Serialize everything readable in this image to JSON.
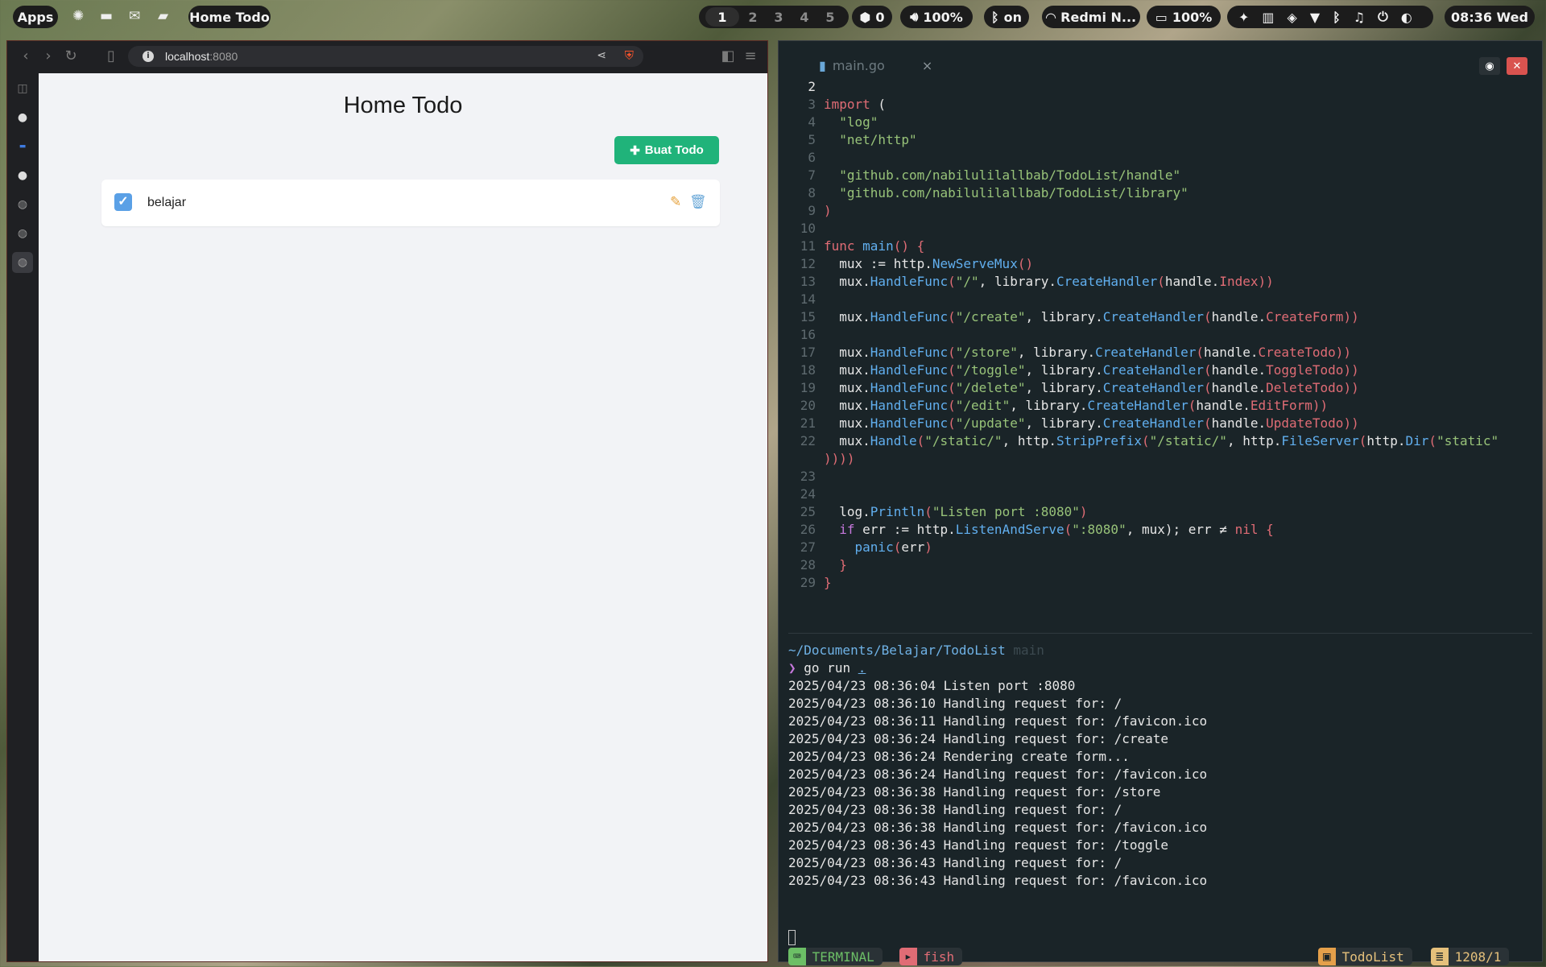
{
  "topbar": {
    "apps_label": "Apps",
    "active_window_title": "Home Todo",
    "workspaces": [
      "1",
      "2",
      "3",
      "4",
      "5"
    ],
    "windows_count": "0",
    "volume": "100%",
    "bluetooth": "on",
    "wifi": "Redmi N...",
    "battery": "100%",
    "clock": "08:36 Wed"
  },
  "browser": {
    "url_host": "localhost",
    "url_port": ":8080"
  },
  "todo_app": {
    "title": "Home Todo",
    "create_button": "Buat Todo",
    "todos": [
      {
        "text": "belajar",
        "done": true
      }
    ]
  },
  "editor": {
    "tab_name": "main.go",
    "close_glyph": "×",
    "current_line_number": "2"
  },
  "terminal": {
    "cwd": "~/Documents/Belajar/TodoList",
    "branch": "main",
    "prompt_symbol": "❯",
    "command": "go run",
    "command_arg": ".",
    "output": [
      "2025/04/23 08:36:04 Listen port :8080",
      "2025/04/23 08:36:10 Handling request for: /",
      "2025/04/23 08:36:11 Handling request for: /favicon.ico",
      "2025/04/23 08:36:24 Handling request for: /create",
      "2025/04/23 08:36:24 Rendering create form...",
      "2025/04/23 08:36:24 Handling request for: /favicon.ico",
      "2025/04/23 08:36:38 Handling request for: /store",
      "2025/04/23 08:36:38 Handling request for: /",
      "2025/04/23 08:36:38 Handling request for: /favicon.ico",
      "2025/04/23 08:36:43 Handling request for: /toggle",
      "2025/04/23 08:36:43 Handling request for: /",
      "2025/04/23 08:36:43 Handling request for: /favicon.ico"
    ]
  },
  "statusbar": {
    "mode": "TERMINAL",
    "shell": "fish",
    "project": "TodoList",
    "position": "1208/1"
  },
  "colors": {
    "accent_green": "#20b37a",
    "terminal_bg": "#1a2428",
    "keyword": "#e06c75",
    "function": "#61afef",
    "string": "#98c379"
  }
}
